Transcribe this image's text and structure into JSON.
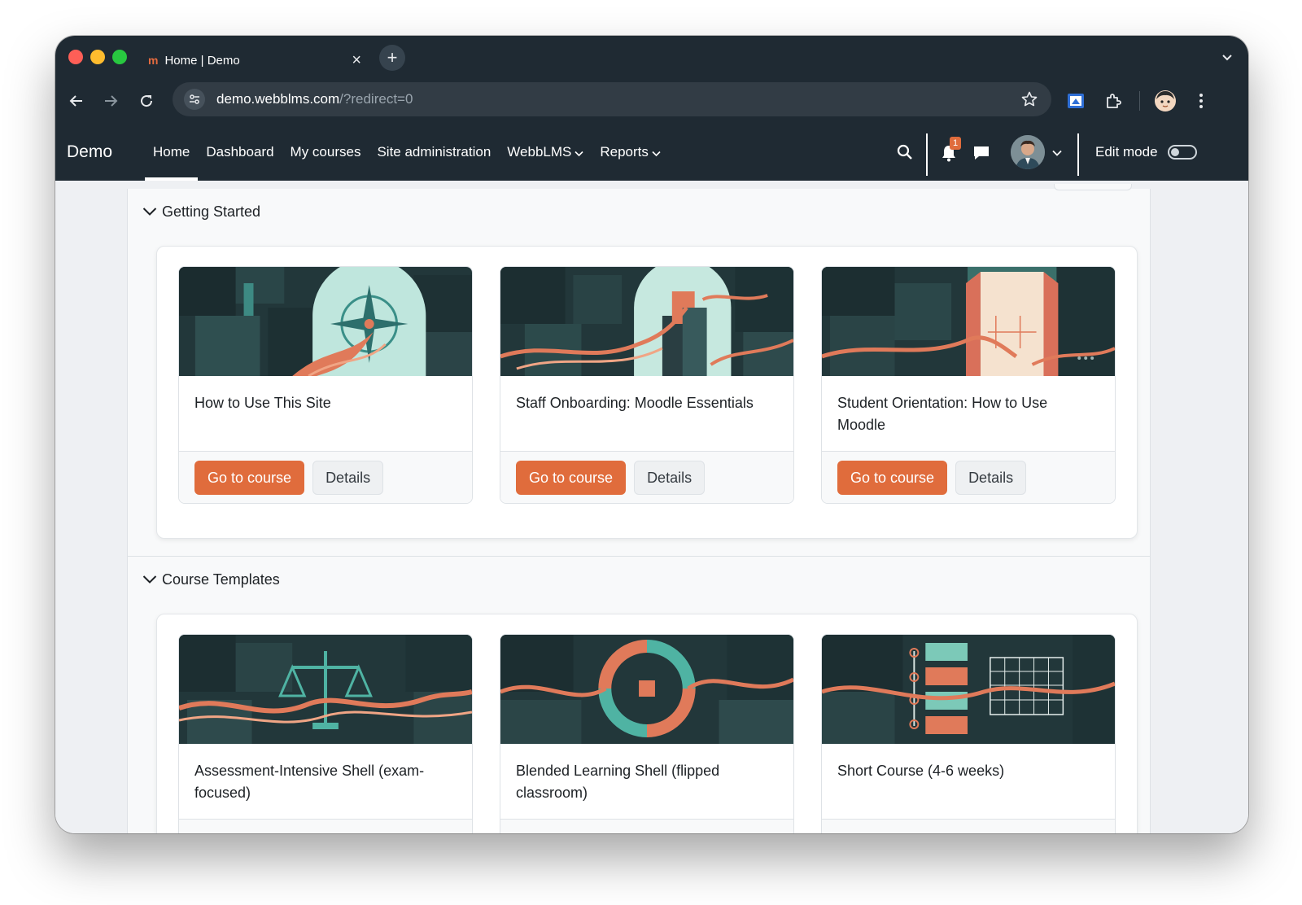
{
  "browser": {
    "tab_title": "Home | Demo",
    "tab_favicon_text": "m",
    "close_glyph": "×",
    "newtab_glyph": "+",
    "url_host": "demo.webblms.com",
    "url_path": "/?redirect=0"
  },
  "navbar": {
    "brand": "Demo",
    "links": [
      {
        "label": "Home",
        "active": true
      },
      {
        "label": "Dashboard"
      },
      {
        "label": "My courses"
      },
      {
        "label": "Site administration"
      },
      {
        "label": "WebbLMS",
        "dropdown": true
      },
      {
        "label": "Reports",
        "dropdown": true
      }
    ],
    "notification_count": "1",
    "edit_mode_label": "Edit mode"
  },
  "sections": [
    {
      "title": "Getting Started",
      "courses": [
        {
          "title": "How to Use This Site",
          "image": "compass",
          "primary": "Go to course",
          "secondary": "Details"
        },
        {
          "title": "Staff Onboarding: Moodle Essentials",
          "image": "tower",
          "primary": "Go to course",
          "secondary": "Details"
        },
        {
          "title": "Student Orientation: How to Use Moodle",
          "image": "door",
          "primary": "Go to course",
          "secondary": "Details"
        }
      ]
    },
    {
      "title": "Course Templates",
      "courses": [
        {
          "title": "Assessment-Intensive Shell (exam-focused)",
          "image": "scales"
        },
        {
          "title": "Blended Learning Shell (flipped classroom)",
          "image": "cycle"
        },
        {
          "title": "Short Course (4-6 weeks)",
          "image": "calendar"
        }
      ]
    }
  ],
  "colors": {
    "navbar_bg": "#1f2a33",
    "primary_button": "#e06c3c",
    "page_bg": "#eef0f3",
    "art_dark": "#22373a",
    "art_teal": "#4fb3a3",
    "art_orange": "#e07a5a"
  }
}
